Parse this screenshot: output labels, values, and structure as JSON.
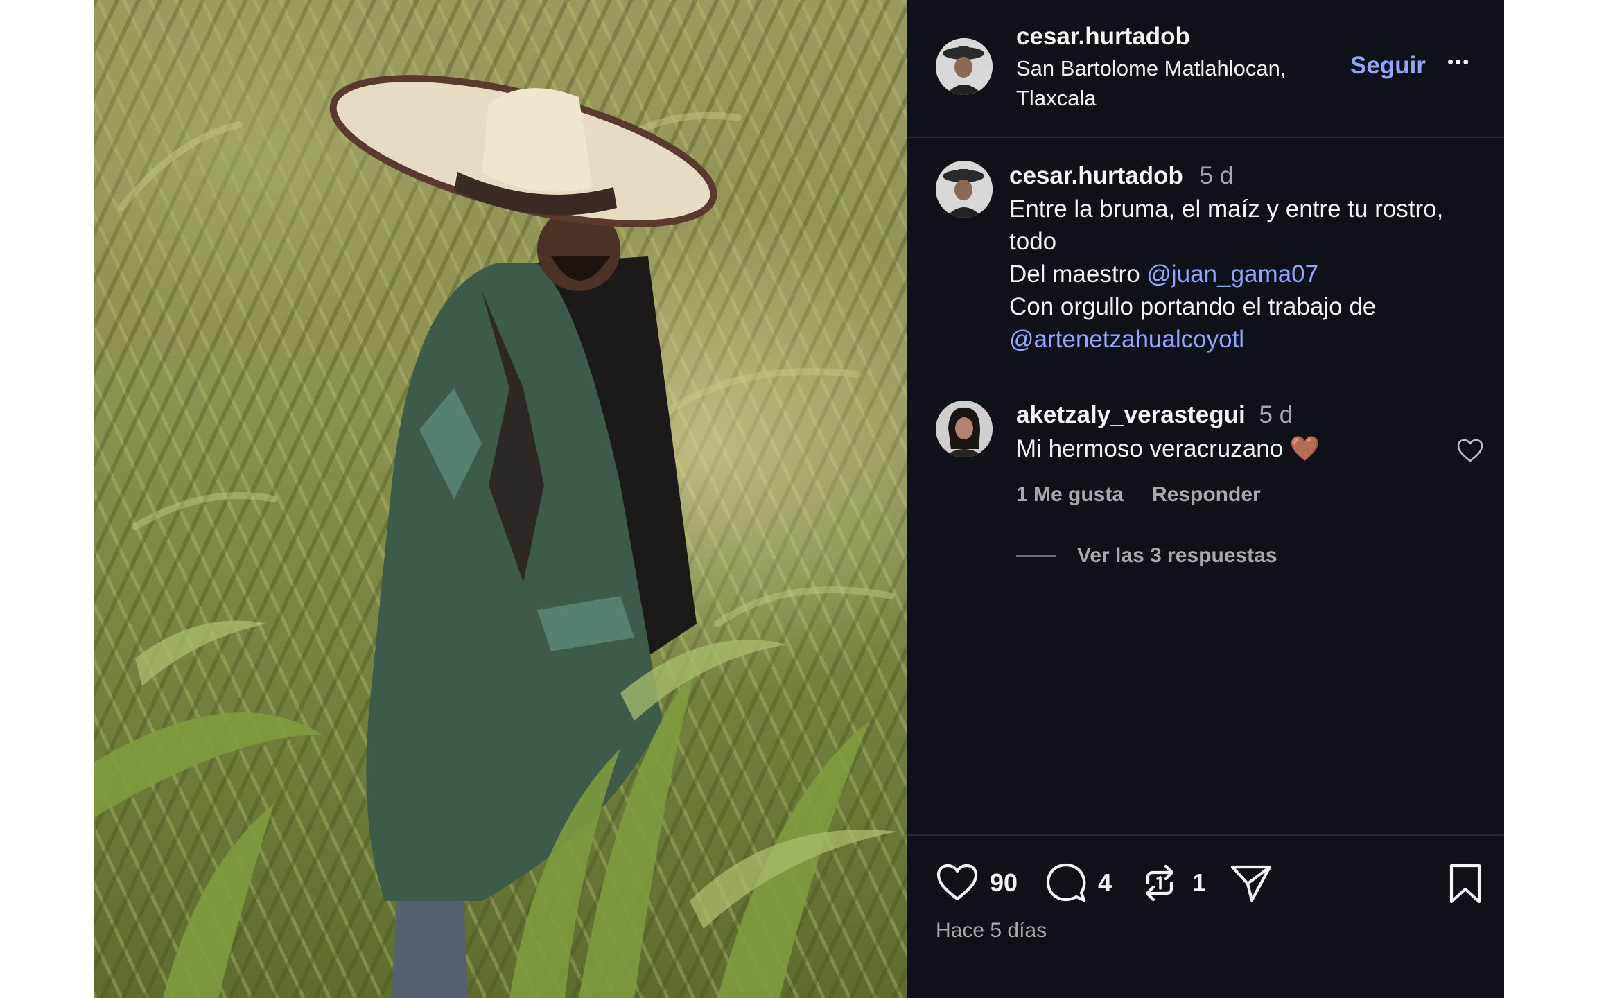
{
  "post": {
    "username": "cesar.hurtadob",
    "location_line1": "San Bartolome Matlahlocan,",
    "location_line2": "Tlaxcala",
    "follow_label": "Seguir",
    "more_label": "•••"
  },
  "caption": {
    "username": "cesar.hurtadob",
    "age": "5 d",
    "line1": "Entre la bruma, el maíz y entre tu rostro,",
    "line2": "todo",
    "line3_text": "Del maestro ",
    "line3_mention": "@juan_gama07",
    "line4": "Con orgullo portando el trabajo de",
    "line5_mention": "@artenetzahualcoyotl"
  },
  "comment": {
    "username": "aketzaly_verastegui",
    "age": "5 d",
    "text": "Mi hermoso veracruzano",
    "emoji": "🤎",
    "likes_label": "1 Me gusta",
    "reply_label": "Responder",
    "view_replies_label": "Ver las 3 respuestas"
  },
  "actions": {
    "likes": "90",
    "comments": "4",
    "reposts": "1",
    "timestamp": "Hace 5 días"
  },
  "colors": {
    "panel_bg": "#0f1118",
    "link": "#8ea6ff",
    "muted": "#a8a8a8"
  }
}
